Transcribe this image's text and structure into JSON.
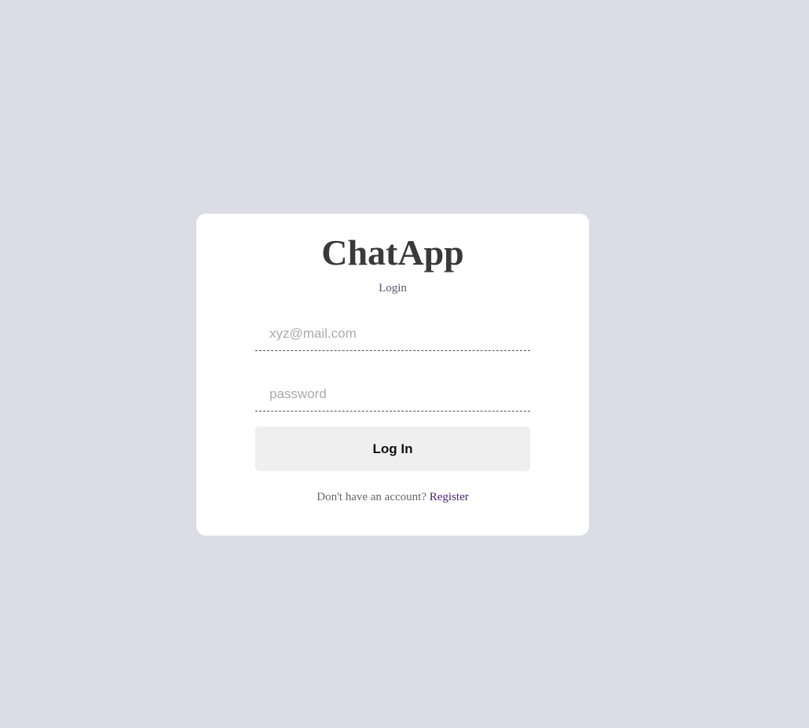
{
  "app": {
    "brand": "ChatApp",
    "subtitle": "Login"
  },
  "form": {
    "email": {
      "placeholder": "xyz@mail.com",
      "value": ""
    },
    "password": {
      "placeholder": "password",
      "value": ""
    },
    "submit_label": "Log In"
  },
  "footer": {
    "prompt": "Don't have an account?",
    "link_label": "Register"
  },
  "colors": {
    "background": "#dcdce6",
    "card": "#ffffff",
    "brand_text": "#3a3a3a",
    "subtitle_text": "#5a5275",
    "button_bg": "#efefef",
    "link": "#4b1f78"
  }
}
